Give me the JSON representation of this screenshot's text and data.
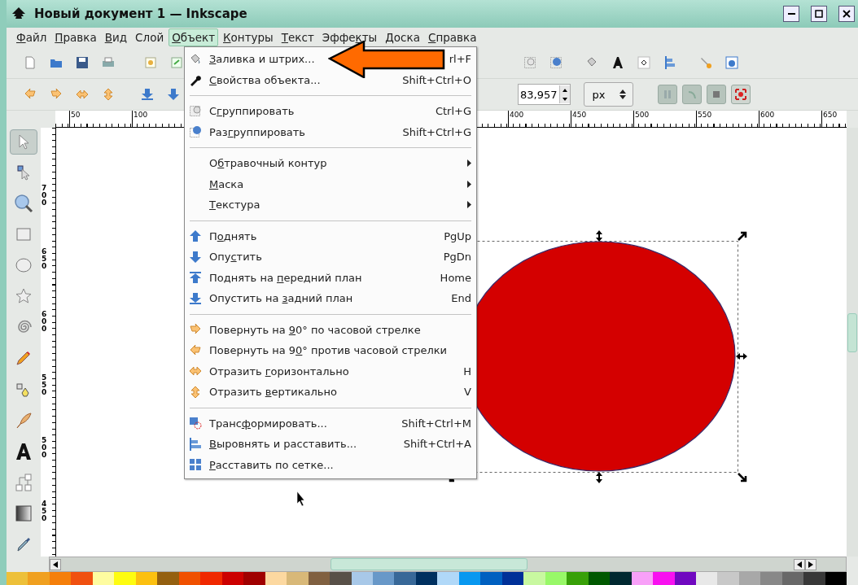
{
  "window": {
    "title": "Новый документ 1 — Inkscape"
  },
  "menubar": [
    {
      "key": "Ф",
      "post": "айл",
      "selected": false
    },
    {
      "key": "П",
      "post": "равка",
      "selected": false
    },
    {
      "key": "В",
      "post": "ид",
      "selected": false
    },
    {
      "pre": "Слой",
      "selected": false
    },
    {
      "key": "О",
      "post": "бъект",
      "selected": true
    },
    {
      "key": "К",
      "post": "онтуры",
      "selected": false
    },
    {
      "key": "Т",
      "post": "екст",
      "selected": false
    },
    {
      "pre": "Эффе",
      "key": "к",
      "post": "ты",
      "selected": false
    },
    {
      "key": "Д",
      "post": "оска",
      "selected": false
    },
    {
      "key": "С",
      "post": "правка",
      "selected": false
    }
  ],
  "toolbar_controls": {
    "spin_value": "83,957",
    "unit": "px"
  },
  "ruler_h": [
    "50",
    "100",
    "400",
    "450",
    "500",
    "550",
    "600",
    "650"
  ],
  "ruler_v": [
    "700",
    "650",
    "600",
    "550",
    "500",
    "450"
  ],
  "toolbox": [
    {
      "selected": true
    },
    {
      "selected": false
    },
    {
      "selected": false
    },
    {
      "selected": false
    },
    {
      "selected": false
    },
    {
      "selected": false
    },
    {
      "selected": false
    },
    {
      "selected": false
    },
    {
      "selected": false
    },
    {
      "selected": false
    },
    {
      "selected": false
    },
    {
      "selected": false
    },
    {
      "selected": false
    },
    {
      "selected": false
    }
  ],
  "object_menu": [
    {
      "kind": "item",
      "key": "З",
      "post": "аливка и штрих...",
      "shortcut": "rl+F"
    },
    {
      "kind": "item",
      "key": "С",
      "post": "войства объекта...",
      "shortcut": "Shift+Ctrl+O"
    },
    {
      "kind": "separator"
    },
    {
      "kind": "item",
      "pre": "С",
      "key": "г",
      "post": "руппировать",
      "shortcut": "Ctrl+G"
    },
    {
      "kind": "item",
      "pre": "Раз",
      "key": "г",
      "post": "руппировать",
      "shortcut": "Shift+Ctrl+G"
    },
    {
      "kind": "separator"
    },
    {
      "kind": "submenu",
      "pre": "О",
      "key": "б",
      "post": "травочный контур"
    },
    {
      "kind": "submenu",
      "key": "М",
      "post": "аска"
    },
    {
      "kind": "submenu",
      "key": "Т",
      "post": "екстура"
    },
    {
      "kind": "separator"
    },
    {
      "kind": "item",
      "pre": "П",
      "key": "о",
      "post": "днять",
      "shortcut": "PgUp"
    },
    {
      "kind": "item",
      "pre": "Опу",
      "key": "с",
      "post": "тить",
      "shortcut": "PgDn"
    },
    {
      "kind": "item",
      "pre": "Поднять на ",
      "key": "п",
      "post": "ередний план",
      "shortcut": "Home"
    },
    {
      "kind": "item",
      "pre": "Опустить на ",
      "key": "з",
      "post": "адний план",
      "shortcut": "End"
    },
    {
      "kind": "separator"
    },
    {
      "kind": "item",
      "pre": "Повернуть на ",
      "key": "9",
      "post": "0° по часовой стрелке"
    },
    {
      "kind": "item",
      "pre": "Повернуть на 9",
      "key": "0",
      "post": "° против часовой стрелки"
    },
    {
      "kind": "item",
      "pre": "Отразить ",
      "key": "г",
      "post": "оризонтально",
      "shortcut": "H"
    },
    {
      "kind": "item",
      "pre": "Отразить ",
      "key": "в",
      "post": "ертикально",
      "shortcut": "V"
    },
    {
      "kind": "separator"
    },
    {
      "kind": "item",
      "pre": "Транс",
      "key": "ф",
      "post": "ормировать...",
      "shortcut": "Shift+Ctrl+M"
    },
    {
      "kind": "item",
      "key": "В",
      "post": "ыровнять и расставить...",
      "shortcut": "Shift+Ctrl+A"
    },
    {
      "kind": "item",
      "key": "Р",
      "post": "асставить по сетке..."
    }
  ],
  "palette": [
    {
      "color": "#edc03a"
    },
    {
      "color": "#f0a020"
    },
    {
      "color": "#f57f0a"
    },
    {
      "color": "#f05010"
    },
    {
      "color": "#fefca0"
    },
    {
      "color": "#fefc10"
    },
    {
      "color": "#fcc010"
    },
    {
      "color": "#946010"
    },
    {
      "color": "#f05000"
    },
    {
      "color": "#f02800"
    },
    {
      "color": "#cc0000"
    },
    {
      "color": "#a00000"
    },
    {
      "color": "#fcd8a0"
    },
    {
      "color": "#d8b878"
    },
    {
      "color": "#806040"
    },
    {
      "color": "#585048"
    },
    {
      "color": "#a8c8e8"
    },
    {
      "color": "#6898c8"
    },
    {
      "color": "#386898"
    },
    {
      "color": "#003060"
    },
    {
      "color": "#b0d8f8"
    },
    {
      "color": "#0898f0"
    },
    {
      "color": "#0060c0"
    },
    {
      "color": "#003098"
    },
    {
      "color": "#c8f8a0"
    },
    {
      "color": "#98f868"
    },
    {
      "color": "#38a008"
    },
    {
      "color": "#005800"
    },
    {
      "color": "#002830"
    },
    {
      "color": "#f8a0f8"
    },
    {
      "color": "#f810f0"
    },
    {
      "color": "#7008c0"
    },
    {
      "color": "#e8e8e8"
    },
    {
      "color": "#c8c8c8"
    },
    {
      "color": "#a8a8a8"
    },
    {
      "color": "#888888"
    },
    {
      "color": "#686868"
    },
    {
      "color": "#383838"
    },
    {
      "color": "#000000"
    }
  ]
}
